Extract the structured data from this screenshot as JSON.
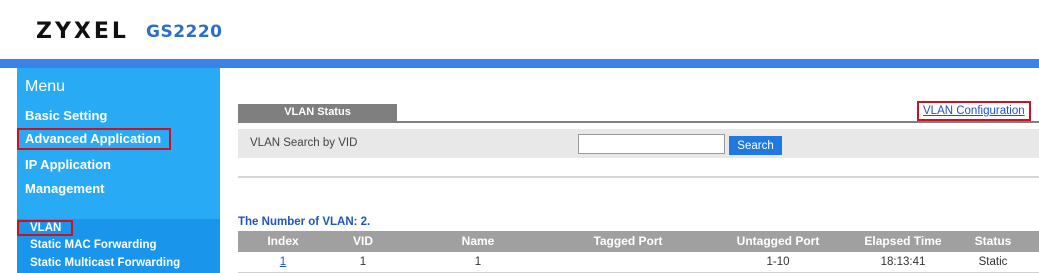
{
  "header": {
    "brand": "ZYXEL",
    "model": "GS2220"
  },
  "sidebar": {
    "title": "Menu",
    "items": [
      {
        "label": "Basic Setting"
      },
      {
        "label": "Advanced Application"
      },
      {
        "label": "IP Application"
      },
      {
        "label": "Management"
      }
    ],
    "subitems": [
      {
        "label": "VLAN"
      },
      {
        "label": "Static MAC Forwarding"
      },
      {
        "label": "Static Multicast Forwarding"
      }
    ]
  },
  "main": {
    "tab_label": "VLAN Status",
    "config_link": "VLAN Configuration",
    "search": {
      "label": "VLAN Search by VID",
      "value": "",
      "button": "Search"
    },
    "vlan_count": "The Number of VLAN: 2.",
    "table": {
      "headers": [
        "Index",
        "VID",
        "Name",
        "Tagged Port",
        "Untagged Port",
        "Elapsed Time",
        "Status"
      ],
      "rows": [
        [
          "1",
          "1",
          "1",
          "",
          "1-10",
          "18:13:41",
          "Static"
        ]
      ]
    }
  },
  "colors": {
    "accent": "#3b82e6",
    "sidebar": "#29aaf5",
    "highlight": "#cc1122"
  }
}
